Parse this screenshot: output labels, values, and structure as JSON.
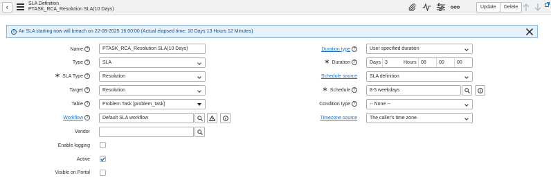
{
  "header": {
    "title": "SLA Definition",
    "subtitle": "PTASK_RCA_Resolution SLA(10 Days)",
    "update_label": "Update",
    "delete_label": "Delete"
  },
  "alert": {
    "text": "An SLA starting now will breach on 22-08-2025 16:00:00 (Actual elapsed time: 10 Days 13 Hours 12 Minutes)"
  },
  "form": {
    "name": {
      "label": "Name",
      "value": "PTASK_RCA_Resolution SLA(10 Days)"
    },
    "type": {
      "label": "Type",
      "value": "SLA"
    },
    "sla_type": {
      "label": "SLA Type",
      "value": "Resolution"
    },
    "target": {
      "label": "Target",
      "value": "Resolution"
    },
    "table": {
      "label": "Table",
      "value": "Problem Task [problem_task]"
    },
    "workflow": {
      "label": "Workflow",
      "value": "Default SLA workflow"
    },
    "vendor": {
      "label": "Vendor",
      "value": ""
    },
    "enable_logging": {
      "label": "Enable logging",
      "checked": false
    },
    "active": {
      "label": "Active",
      "checked": true
    },
    "visible_on_portal": {
      "label": "Visible on Portal",
      "checked": false
    },
    "duration_type": {
      "label": "Duration type",
      "value": "User specified duration"
    },
    "duration": {
      "label": "Duration",
      "days_label": "Days",
      "days": "3",
      "hours_label": "Hours",
      "hh": "08",
      "mm": "00",
      "ss": "00"
    },
    "schedule_source": {
      "label": "Schedule source",
      "value": "SLA definition"
    },
    "schedule": {
      "label": "Schedule",
      "value": "8-5 weekdays"
    },
    "condition_type": {
      "label": "Condition type",
      "value": "-- None --"
    },
    "timezone_source": {
      "label": "Timezone source",
      "value": "The caller's time zone"
    }
  },
  "help_glyph": "?",
  "icons": [
    "back-icon",
    "menu-icon",
    "attachment-icon",
    "activity-icon",
    "settings-icon",
    "more-icon",
    "arrow-up-icon",
    "arrow-down-icon",
    "info-icon",
    "close-icon",
    "search-icon",
    "warning-icon",
    "info-circle-icon",
    "checkmark-icon"
  ]
}
